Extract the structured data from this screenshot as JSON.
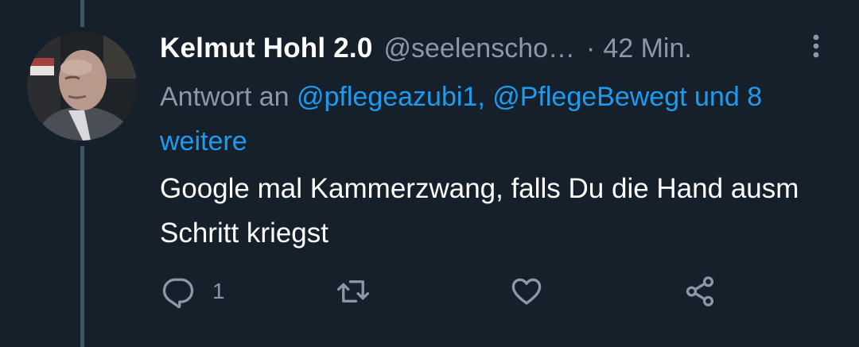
{
  "tweet": {
    "display_name": "Kelmut Hohl 2.0",
    "handle": "@seelenscho…",
    "separator": "·",
    "time_ago": "42 Min.",
    "reply_prefix": "Antwort an",
    "mention_1": "@pflegeazubi1,",
    "mention_2": "@PflegeBewegt",
    "mention_more": "und 8 weitere",
    "text": "Google mal Kammerzwang, falls Du die Hand ausm Schritt kriegst"
  },
  "actions": {
    "reply_count": "1"
  },
  "icons": {
    "reply": "reply-icon",
    "retweet": "retweet-icon",
    "like": "like-icon",
    "share": "share-icon",
    "more": "more-icon"
  },
  "colors": {
    "background": "#15202b",
    "text_primary": "#ffffff",
    "text_secondary": "#8b98a5",
    "accent": "#1d9bf0",
    "thread_line": "#3d5466"
  }
}
